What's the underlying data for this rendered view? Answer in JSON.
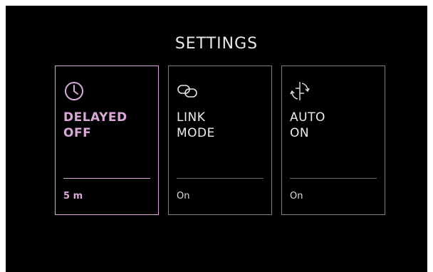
{
  "screen": {
    "title": "SETTINGS"
  },
  "cards": [
    {
      "icon": "clock-icon",
      "label_line1": "DELAYED",
      "label_line2": "OFF",
      "value": "5 m",
      "selected": true
    },
    {
      "icon": "link-icon",
      "label_line1": "LINK",
      "label_line2": "MODE",
      "value": "On",
      "selected": false
    },
    {
      "icon": "rotate-icon",
      "label_line1": "AUTO",
      "label_line2": "ON",
      "value": "On",
      "selected": false
    }
  ],
  "colors": {
    "background": "#000000",
    "accent": "#d9a8d8",
    "border": "#7e7e7e",
    "text": "#ececec"
  }
}
